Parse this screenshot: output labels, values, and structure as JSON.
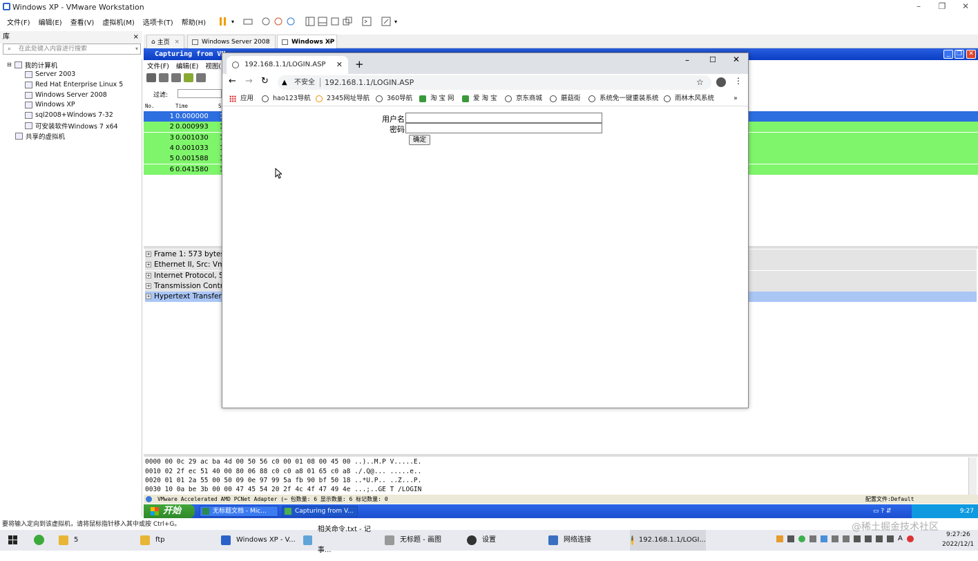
{
  "vmware": {
    "title": "Windows XP - VMware Workstation",
    "menu": [
      "文件(F)",
      "编辑(E)",
      "查看(V)",
      "虚拟机(M)",
      "选项卡(T)",
      "帮助(H)"
    ],
    "library": {
      "title": "库",
      "close": "×",
      "search_placeholder": "在此处键入内容进行搜索",
      "tree": {
        "root": "我的计算机",
        "items": [
          "Server 2003",
          "Red Hat Enterprise Linux 5",
          "Windows Server 2008",
          "Windows XP",
          "sql2008+Windows 7-32",
          "可安装软件Windows 7 x64"
        ],
        "shared": "共享的虚拟机"
      }
    },
    "tabs": [
      {
        "label": "主页"
      },
      {
        "label": "Windows Server 2008"
      },
      {
        "label": "Windows XP"
      }
    ],
    "status_bar": "要将输入定向到该虚拟机，请将鼠标指针移入其中或按 Ctrl+G。"
  },
  "wireshark": {
    "title": "Capturing from VM",
    "menu": [
      "文件(F)",
      "编辑(E)",
      "视图("
    ],
    "filter_label": "过滤:",
    "columns": {
      "no": "No.",
      "time": "Time",
      "s": "S"
    },
    "packets": [
      {
        "no": "1",
        "time": "0.000000",
        "c": "1"
      },
      {
        "no": "2",
        "time": "0.000993",
        "c": "1"
      },
      {
        "no": "3",
        "time": "0.001030",
        "c": "1"
      },
      {
        "no": "4",
        "time": "0.001033",
        "c": "1"
      },
      {
        "no": "5",
        "time": "0.001588",
        "c": "1"
      },
      {
        "no": "6",
        "time": "0.041580",
        "c": "1"
      }
    ],
    "details": [
      "Frame 1: 573 bytes",
      "Ethernet II, Src: Vm",
      "Internet Protocol, Sr",
      "Transmission Contro",
      "Hypertext Transfer F"
    ],
    "hex": [
      "0000  00 0c 29 ac ba 4d 00 50  56 c0 00 01 08 00 45 00   ..)..M.P V.....E.",
      "0010  02 2f ec 51 40 00 80 06  88 c0 c0 a8 01 65 c0 a8   ./.Q@... .....e..",
      "0020  01 01 2a 55 00 50 09 0e  97 99 5a fb 90 bf 50 18   ..*U.P.. ..Z...P.",
      "0030  10 0a be 3b 00 00 47 45  54 20 2f 4c 4f 47 49 4e   ...;..GE T /LOGIN"
    ],
    "status": "VMware Accelerated AMD PCNet Adapter (⋯ 包数量: 6 显示数量: 6 标记数量: 0",
    "status_right": "配置文件:Default"
  },
  "xp": {
    "start": "开始",
    "tasks": [
      "无标题文档 - Mic...",
      "Capturing from V..."
    ],
    "clock": "9:27"
  },
  "chrome": {
    "tab_title": "192.168.1.1/LOGIN.ASP",
    "new_tab": "+",
    "insecure": "不安全",
    "url": "192.168.1.1/LOGIN.ASP",
    "bookmarks": [
      "应用",
      "hao123导航",
      "2345网址导航",
      "360导航",
      "淘 宝 网",
      "爱 淘 宝",
      "京东商城",
      "蘑菇街",
      "系统免一键重装系统",
      "雨林木风系统"
    ],
    "more": "»",
    "form": {
      "username_label": "用户名",
      "password_label": "密码",
      "submit": "确定"
    }
  },
  "win10": {
    "items": [
      "5",
      "ftp",
      "Windows XP - V...",
      "相关命令.txt - 记事...",
      "无标题 - 画图",
      "设置",
      "网络连接",
      "192.168.1.1/LOGI..."
    ],
    "time": "9:27:26",
    "date": "2022/12/1",
    "watermark": "@稀土掘金技术社区"
  },
  "colors": {
    "packet_selected": "#2d6ee0",
    "packet_green": "#7ff56b",
    "xp_title": "#0a3ec4",
    "detail_selected": "#a9c6f5"
  }
}
